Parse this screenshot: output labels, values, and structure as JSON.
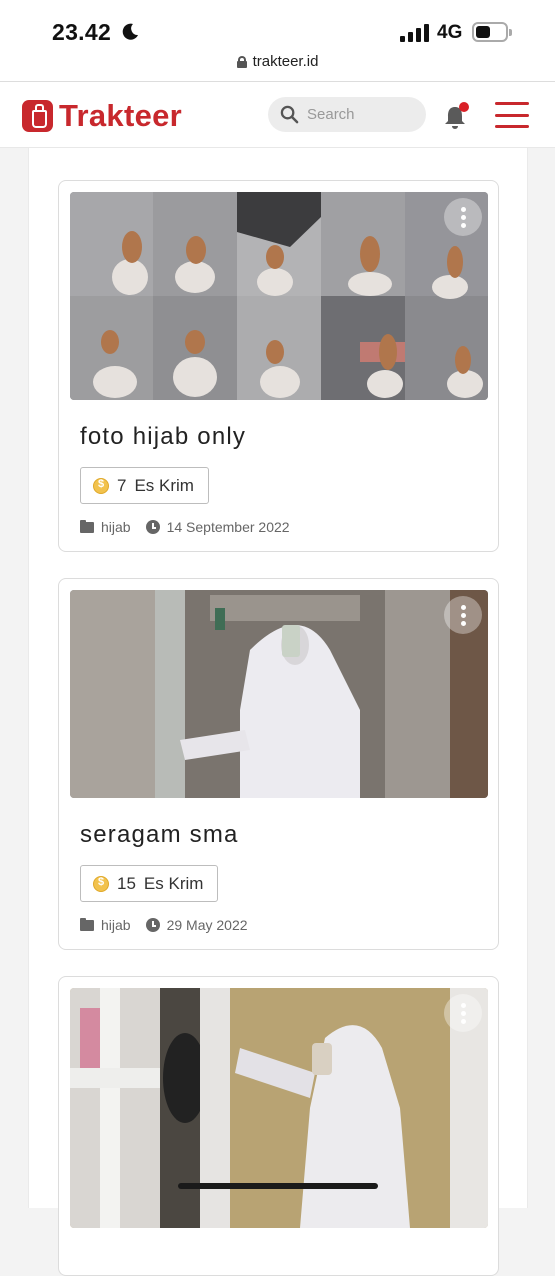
{
  "status_bar": {
    "time": "23.42",
    "network": "4G",
    "moon_icon": "moon-icon",
    "battery_icon": "battery-icon"
  },
  "browser": {
    "url": "trakteer.id",
    "lock_icon": "lock-icon"
  },
  "header": {
    "logo_text": "Trakteer",
    "search_placeholder": "Search",
    "brand_color": "#c8282d",
    "notification_badge_color": "#d92027"
  },
  "posts": [
    {
      "title": "foto hijab only",
      "price_amount": "7",
      "price_unit": "Es Krim",
      "category": "hijab",
      "date": "14 September 2022"
    },
    {
      "title": "seragam sma",
      "price_amount": "15",
      "price_unit": "Es Krim",
      "category": "hijab",
      "date": "29 May 2022"
    },
    {
      "title": "",
      "price_amount": "",
      "price_unit": "",
      "category": "",
      "date": ""
    }
  ]
}
